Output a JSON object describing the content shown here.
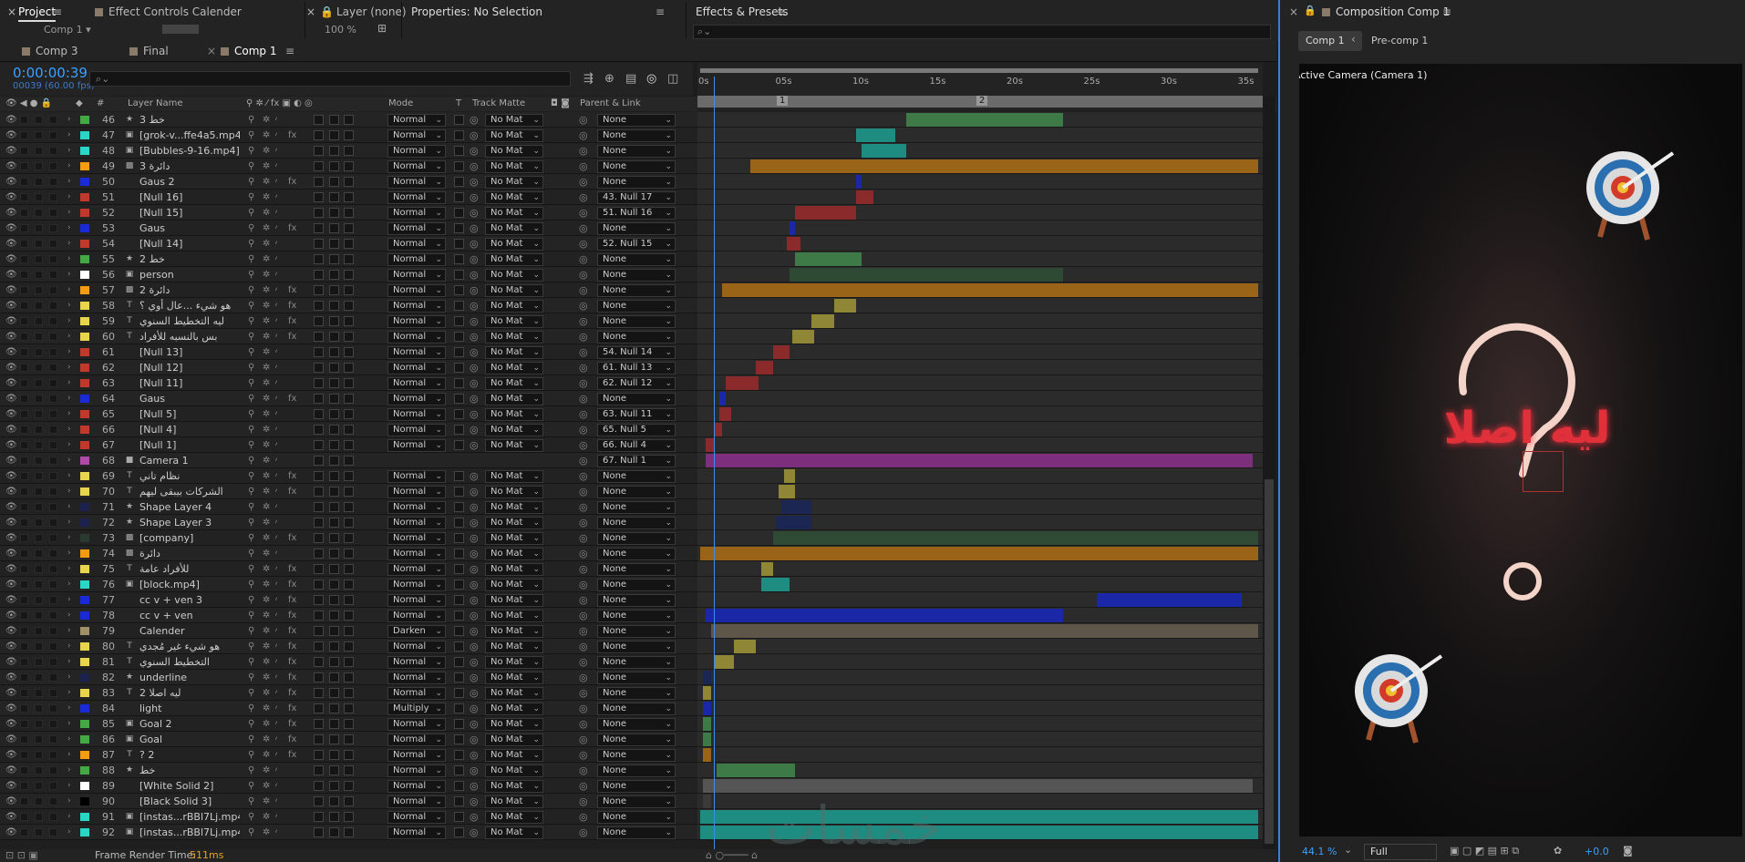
{
  "top_tabs": {
    "project": "Project",
    "effect_controls": "Effect Controls Calender",
    "layer": "Layer (none)",
    "properties": "Properties: No Selection",
    "effects_presets": "Effects & Presets",
    "composition": "Composition Comp 1"
  },
  "project_sub": "Comp 1 ▾",
  "layer_zoom": "100 %",
  "comp_tabs": [
    "Comp 3",
    "Final",
    "Comp 1"
  ],
  "timecode": "0:00:00:39",
  "fps": "00039 (60.00 fps)",
  "search_placeholder": "⌕⌄",
  "columns": {
    "layer_name": "Layer Name",
    "hash": "#",
    "mode": "Mode",
    "t": "T",
    "track_matte": "Track Matte",
    "parent": "Parent & Link"
  },
  "ruler_ticks": [
    "0s",
    "05s",
    "10s",
    "15s",
    "20s",
    "25s",
    "30s",
    "35s"
  ],
  "markers": [
    "1",
    "2"
  ],
  "layers": [
    {
      "num": "46",
      "icon": "★",
      "name": "خط 3",
      "label": "#44a844",
      "mode": "Normal",
      "matte": "No Mat",
      "parent": "None",
      "fx": false,
      "bar": {
        "color": "#3d7a47",
        "start": 0.37,
        "end": 0.65
      }
    },
    {
      "num": "47",
      "icon": "▣",
      "name": "[grok-v...ffe4a5.mp4]",
      "label": "#2ad6c6",
      "mode": "Normal",
      "matte": "No Mat",
      "parent": "None",
      "fx": true,
      "bar": {
        "color": "#1e8c80",
        "start": 0.28,
        "end": 0.35
      }
    },
    {
      "num": "48",
      "icon": "▣",
      "name": "[Bubbles-9-16.mp4]",
      "label": "#2ad6c6",
      "mode": "Normal",
      "matte": "No Mat",
      "parent": "None",
      "fx": false,
      "bar": {
        "color": "#1e8c80",
        "start": 0.29,
        "end": 0.37
      }
    },
    {
      "num": "49",
      "icon": "▩",
      "name": "دائرة 3",
      "label": "#f39c12",
      "mode": "Normal",
      "matte": "No Mat",
      "parent": "None",
      "fx": false,
      "bar": {
        "color": "#9a6418",
        "start": 0.09,
        "end": 1.0
      }
    },
    {
      "num": "50",
      "icon": "",
      "name": "Gaus 2",
      "label": "#1a2ad6",
      "mode": "Normal",
      "matte": "No Mat",
      "parent": "None",
      "fx": true,
      "bar": {
        "color": "#1a28a8",
        "start": 0.28,
        "end": 0.29
      }
    },
    {
      "num": "51",
      "icon": "",
      "name": "[Null 16]",
      "label": "#c0392b",
      "mode": "Normal",
      "matte": "No Mat",
      "parent": "43. Null 17",
      "fx": false,
      "bar": {
        "color": "#8a2a2a",
        "start": 0.28,
        "end": 0.31
      }
    },
    {
      "num": "52",
      "icon": "",
      "name": "[Null 15]",
      "label": "#c0392b",
      "mode": "Normal",
      "matte": "No Mat",
      "parent": "51. Null 16",
      "fx": false,
      "bar": {
        "color": "#8a2a2a",
        "start": 0.17,
        "end": 0.28
      }
    },
    {
      "num": "53",
      "icon": "",
      "name": "Gaus",
      "label": "#1a2ad6",
      "mode": "Normal",
      "matte": "No Mat",
      "parent": "None",
      "fx": true,
      "bar": {
        "color": "#1a28a8",
        "start": 0.16,
        "end": 0.17
      }
    },
    {
      "num": "54",
      "icon": "",
      "name": "[Null 14]",
      "label": "#c0392b",
      "mode": "Normal",
      "matte": "No Mat",
      "parent": "52. Null 15",
      "fx": false,
      "bar": {
        "color": "#8a2a2a",
        "start": 0.155,
        "end": 0.18
      }
    },
    {
      "num": "55",
      "icon": "★",
      "name": "خط 2",
      "label": "#44a844",
      "mode": "Normal",
      "matte": "No Mat",
      "parent": "None",
      "fx": false,
      "bar": {
        "color": "#3d7a47",
        "start": 0.17,
        "end": 0.29
      }
    },
    {
      "num": "56",
      "icon": "▣",
      "name": "person",
      "label": "#ffffff",
      "mode": "Normal",
      "matte": "No Mat",
      "parent": "None",
      "fx": false,
      "bar": {
        "color": "#2f4a34",
        "start": 0.16,
        "end": 0.65
      }
    },
    {
      "num": "57",
      "icon": "▩",
      "name": "دائرة 2",
      "label": "#f39c12",
      "mode": "Normal",
      "matte": "No Mat",
      "parent": "None",
      "fx": true,
      "bar": {
        "color": "#9a6418",
        "start": 0.04,
        "end": 1.0
      }
    },
    {
      "num": "58",
      "icon": "T",
      "name": "هو شيء ...عال أوي ؟",
      "label": "#e8d44d",
      "mode": "Normal",
      "matte": "No Mat",
      "parent": "None",
      "fx": true,
      "bar": {
        "color": "#8f8636",
        "start": 0.24,
        "end": 0.28
      }
    },
    {
      "num": "59",
      "icon": "T",
      "name": "ليه التخطيط السنوي",
      "label": "#e8d44d",
      "mode": "Normal",
      "matte": "No Mat",
      "parent": "None",
      "fx": true,
      "bar": {
        "color": "#8f8636",
        "start": 0.2,
        "end": 0.24
      }
    },
    {
      "num": "60",
      "icon": "T",
      "name": "بس بالنسبه للأفراد",
      "label": "#e8d44d",
      "mode": "Normal",
      "matte": "No Mat",
      "parent": "None",
      "fx": true,
      "bar": {
        "color": "#8f8636",
        "start": 0.165,
        "end": 0.205
      }
    },
    {
      "num": "61",
      "icon": "",
      "name": "[Null 13]",
      "label": "#c0392b",
      "mode": "Normal",
      "matte": "No Mat",
      "parent": "54. Null 14",
      "fx": false,
      "bar": {
        "color": "#8a2a2a",
        "start": 0.13,
        "end": 0.16
      }
    },
    {
      "num": "62",
      "icon": "",
      "name": "[Null 12]",
      "label": "#c0392b",
      "mode": "Normal",
      "matte": "No Mat",
      "parent": "61. Null 13",
      "fx": false,
      "bar": {
        "color": "#8a2a2a",
        "start": 0.1,
        "end": 0.13
      }
    },
    {
      "num": "63",
      "icon": "",
      "name": "[Null 11]",
      "label": "#c0392b",
      "mode": "Normal",
      "matte": "No Mat",
      "parent": "62. Null 12",
      "fx": false,
      "bar": {
        "color": "#8a2a2a",
        "start": 0.045,
        "end": 0.105
      }
    },
    {
      "num": "64",
      "icon": "",
      "name": "Gaus",
      "label": "#1a2ad6",
      "mode": "Normal",
      "matte": "No Mat",
      "parent": "None",
      "fx": true,
      "bar": {
        "color": "#1a28a8",
        "start": 0.035,
        "end": 0.045
      }
    },
    {
      "num": "65",
      "icon": "",
      "name": "[Null 5]",
      "label": "#c0392b",
      "mode": "Normal",
      "matte": "No Mat",
      "parent": "63. Null 11",
      "fx": false,
      "bar": {
        "color": "#8a2a2a",
        "start": 0.035,
        "end": 0.055
      }
    },
    {
      "num": "66",
      "icon": "",
      "name": "[Null 4]",
      "label": "#c0392b",
      "mode": "Normal",
      "matte": "No Mat",
      "parent": "65. Null 5",
      "fx": false,
      "bar": {
        "color": "#8a2a2a",
        "start": 0.025,
        "end": 0.04
      }
    },
    {
      "num": "67",
      "icon": "",
      "name": "[Null 1]",
      "label": "#c0392b",
      "mode": "Normal",
      "matte": "No Mat",
      "parent": "66. Null 4",
      "fx": false,
      "bar": {
        "color": "#8a2a2a",
        "start": 0.01,
        "end": 0.025
      }
    },
    {
      "num": "68",
      "icon": "■",
      "name": "Camera 1",
      "label": "#b04aa8",
      "mode": "",
      "matte": "",
      "parent": "67. Null 1",
      "fx": false,
      "bar": {
        "color": "#7d2f7e",
        "start": 0.01,
        "end": 0.99
      }
    },
    {
      "num": "69",
      "icon": "T",
      "name": "نظام تاني",
      "label": "#e8d44d",
      "mode": "Normal",
      "matte": "No Mat",
      "parent": "None",
      "fx": true,
      "bar": {
        "color": "#8f8636",
        "start": 0.15,
        "end": 0.17
      }
    },
    {
      "num": "70",
      "icon": "T",
      "name": "الشركات بيبقى ليهم",
      "label": "#e8d44d",
      "mode": "Normal",
      "matte": "No Mat",
      "parent": "None",
      "fx": true,
      "bar": {
        "color": "#8f8636",
        "start": 0.14,
        "end": 0.17
      }
    },
    {
      "num": "71",
      "icon": "★",
      "name": "Shape Layer 4",
      "label": "#1b2250",
      "mode": "Normal",
      "matte": "No Mat",
      "parent": "None",
      "fx": false,
      "bar": {
        "color": "#1c2653",
        "start": 0.145,
        "end": 0.2
      }
    },
    {
      "num": "72",
      "icon": "★",
      "name": "Shape Layer 3",
      "label": "#1b2250",
      "mode": "Normal",
      "matte": "No Mat",
      "parent": "None",
      "fx": false,
      "bar": {
        "color": "#1c2653",
        "start": 0.135,
        "end": 0.2
      }
    },
    {
      "num": "73",
      "icon": "▩",
      "name": "[company]",
      "label": "#2a3a30",
      "mode": "Normal",
      "matte": "No Mat",
      "parent": "None",
      "fx": true,
      "bar": {
        "color": "#2f4a34",
        "start": 0.13,
        "end": 1.0
      }
    },
    {
      "num": "74",
      "icon": "▩",
      "name": "دائرة",
      "label": "#f39c12",
      "mode": "Normal",
      "matte": "No Mat",
      "parent": "None",
      "fx": false,
      "bar": {
        "color": "#9a6418",
        "start": 0.0,
        "end": 1.0
      }
    },
    {
      "num": "75",
      "icon": "T",
      "name": "للأفراد عامة",
      "label": "#e8d44d",
      "mode": "Normal",
      "matte": "No Mat",
      "parent": "None",
      "fx": true,
      "bar": {
        "color": "#8f8636",
        "start": 0.11,
        "end": 0.13
      }
    },
    {
      "num": "76",
      "icon": "▣",
      "name": "[block.mp4]",
      "label": "#2ad6c6",
      "mode": "Normal",
      "matte": "No Mat",
      "parent": "None",
      "fx": true,
      "bar": {
        "color": "#1e8c80",
        "start": 0.11,
        "end": 0.16
      }
    },
    {
      "num": "77",
      "icon": "",
      "name": "cc v + ven 3",
      "label": "#1a2ad6",
      "mode": "Normal",
      "matte": "No Mat",
      "parent": "None",
      "fx": true,
      "bar": {
        "color": "#1a28a8",
        "start": 0.71,
        "end": 0.97
      }
    },
    {
      "num": "78",
      "icon": "",
      "name": "cc v + ven",
      "label": "#1a2ad6",
      "mode": "Normal",
      "matte": "No Mat",
      "parent": "None",
      "fx": true,
      "bar": {
        "color": "#1a28a8",
        "start": 0.01,
        "end": 0.65
      }
    },
    {
      "num": "79",
      "icon": "",
      "name": "Calender",
      "label": "#a09068",
      "mode": "Darken",
      "matte": "No Mat",
      "parent": "None",
      "fx": true,
      "bar": {
        "color": "#5e5648",
        "start": 0.02,
        "end": 1.0
      }
    },
    {
      "num": "80",
      "icon": "T",
      "name": "هو شيء غير مُجدي",
      "label": "#e8d44d",
      "mode": "Normal",
      "matte": "No Mat",
      "parent": "None",
      "fx": true,
      "bar": {
        "color": "#8f8636",
        "start": 0.06,
        "end": 0.1
      }
    },
    {
      "num": "81",
      "icon": "T",
      "name": "التخطيط السنوي",
      "label": "#e8d44d",
      "mode": "Normal",
      "matte": "No Mat",
      "parent": "None",
      "fx": true,
      "bar": {
        "color": "#8f8636",
        "start": 0.025,
        "end": 0.06
      }
    },
    {
      "num": "82",
      "icon": "★",
      "name": "underline",
      "label": "#1b2250",
      "mode": "Normal",
      "matte": "No Mat",
      "parent": "None",
      "fx": true,
      "bar": {
        "color": "#1c2653",
        "start": 0.005,
        "end": 0.02
      }
    },
    {
      "num": "83",
      "icon": "T",
      "name": "ليه اصلا 2",
      "label": "#e8d44d",
      "mode": "Normal",
      "matte": "No Mat",
      "parent": "None",
      "fx": true,
      "bar": {
        "color": "#8f8636",
        "start": 0.005,
        "end": 0.02
      }
    },
    {
      "num": "84",
      "icon": "",
      "name": "light",
      "label": "#1a2ad6",
      "mode": "Multiply",
      "matte": "No Mat",
      "parent": "None",
      "fx": true,
      "bar": {
        "color": "#1a28a8",
        "start": 0.005,
        "end": 0.02
      }
    },
    {
      "num": "85",
      "icon": "▣",
      "name": "Goal 2",
      "label": "#44a844",
      "mode": "Normal",
      "matte": "No Mat",
      "parent": "None",
      "fx": true,
      "bar": {
        "color": "#3d7a47",
        "start": 0.005,
        "end": 0.02
      }
    },
    {
      "num": "86",
      "icon": "▣",
      "name": "Goal",
      "label": "#44a844",
      "mode": "Normal",
      "matte": "No Mat",
      "parent": "None",
      "fx": true,
      "bar": {
        "color": "#3d7a47",
        "start": 0.005,
        "end": 0.02
      }
    },
    {
      "num": "87",
      "icon": "T",
      "name": "? 2",
      "label": "#f39c12",
      "mode": "Normal",
      "matte": "No Mat",
      "parent": "None",
      "fx": true,
      "bar": {
        "color": "#9a6418",
        "start": 0.005,
        "end": 0.02
      }
    },
    {
      "num": "88",
      "icon": "★",
      "name": "خط",
      "label": "#44a844",
      "mode": "Normal",
      "matte": "No Mat",
      "parent": "None",
      "fx": false,
      "bar": {
        "color": "#3d7a47",
        "start": 0.03,
        "end": 0.17
      }
    },
    {
      "num": "89",
      "icon": "",
      "name": "[White Solid 2]",
      "label": "#ffffff",
      "mode": "Normal",
      "matte": "No Mat",
      "parent": "None",
      "fx": false,
      "bar": {
        "color": "#555555",
        "start": 0.005,
        "end": 0.99
      }
    },
    {
      "num": "90",
      "icon": "",
      "name": "[Black Solid 3]",
      "label": "#000000",
      "mode": "Normal",
      "matte": "No Mat",
      "parent": "None",
      "fx": false,
      "bar": {
        "color": "#3a3a3a",
        "start": 0.005,
        "end": 0.02
      }
    },
    {
      "num": "91",
      "icon": "▣",
      "name": "[instas...rBBl7Lj.mp4]",
      "label": "#2ad6c6",
      "mode": "Normal",
      "matte": "No Mat",
      "parent": "None",
      "fx": false,
      "bar": {
        "color": "#1e8c80",
        "start": 0.0,
        "end": 1.0
      }
    },
    {
      "num": "92",
      "icon": "▣",
      "name": "[instas...rBBl7Lj.mp4]",
      "label": "#2ad6c6",
      "mode": "Normal",
      "matte": "No Mat",
      "parent": "None",
      "fx": false,
      "bar": {
        "color": "#1e8c80",
        "start": 0.0,
        "end": 1.0
      }
    }
  ],
  "status": {
    "label": "Frame Render Time:",
    "value": "511ms"
  },
  "watermark": "خمسات",
  "comp_nav": {
    "active": "Comp 1",
    "other": "Pre-comp 1"
  },
  "viewer": {
    "camera": "Active Camera (Camera 1)",
    "arabic_text": "ليه اصلا"
  },
  "viewer_bottom": {
    "zoom": "44.1 %",
    "resolution": "Full",
    "exposure": "+0.0"
  },
  "colors": {
    "accent": "#3a8ef0",
    "timecode": "#3ba0ff",
    "neon_red": "#e0303a"
  }
}
